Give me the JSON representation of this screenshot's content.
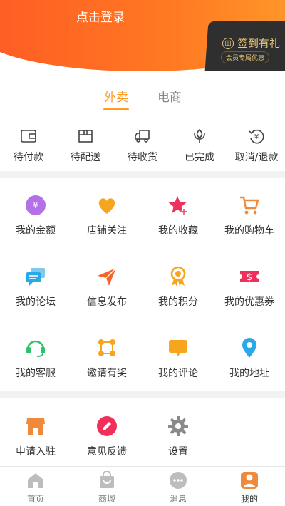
{
  "header": {
    "login_label": "点击登录",
    "checkin_title": "签到有礼",
    "checkin_subtitle": "会员专属优惠"
  },
  "tabs": [
    {
      "label": "外卖",
      "active": true
    },
    {
      "label": "电商",
      "active": false
    }
  ],
  "orders": [
    {
      "label": "待付款",
      "icon": "wallet-icon"
    },
    {
      "label": "待配送",
      "icon": "package-icon"
    },
    {
      "label": "待收货",
      "icon": "delivery-truck-icon"
    },
    {
      "label": "已完成",
      "icon": "flower-icon"
    },
    {
      "label": "取消/退款",
      "icon": "refund-icon"
    }
  ],
  "services": [
    {
      "label": "我的金额",
      "icon": "money-icon",
      "color": "#b470e8"
    },
    {
      "label": "店铺关注",
      "icon": "heart-icon",
      "color": "#f7a51c"
    },
    {
      "label": "我的收藏",
      "icon": "star-icon",
      "color": "#f0305a"
    },
    {
      "label": "我的购物车",
      "icon": "cart-icon",
      "color": "#f08a3a"
    },
    {
      "label": "我的论坛",
      "icon": "forum-icon",
      "color": "#2aa8e8"
    },
    {
      "label": "信息发布",
      "icon": "send-icon",
      "color": "#f5642a"
    },
    {
      "label": "我的积分",
      "icon": "medal-icon",
      "color": "#f7a51c"
    },
    {
      "label": "我的优惠券",
      "icon": "coupon-icon",
      "color": "#f0305a"
    },
    {
      "label": "我的客服",
      "icon": "headset-icon",
      "color": "#2cc36a"
    },
    {
      "label": "邀请有奖",
      "icon": "invite-icon",
      "color": "#f7a51c"
    },
    {
      "label": "我的评论",
      "icon": "comment-icon",
      "color": "#f7a51c"
    },
    {
      "label": "我的地址",
      "icon": "location-icon",
      "color": "#2aa8e8"
    }
  ],
  "more": [
    {
      "label": "申请入驻",
      "icon": "store-icon",
      "color": "#f08a3a"
    },
    {
      "label": "意见反馈",
      "icon": "feedback-icon",
      "color": "#f0305a"
    },
    {
      "label": "设置",
      "icon": "settings-icon",
      "color": "#8a8a8a"
    }
  ],
  "tabbar": [
    {
      "label": "首页",
      "icon": "home-icon"
    },
    {
      "label": "商城",
      "icon": "shop-bag-icon"
    },
    {
      "label": "消息",
      "icon": "message-icon"
    },
    {
      "label": "我的",
      "icon": "profile-icon",
      "active": true
    }
  ]
}
